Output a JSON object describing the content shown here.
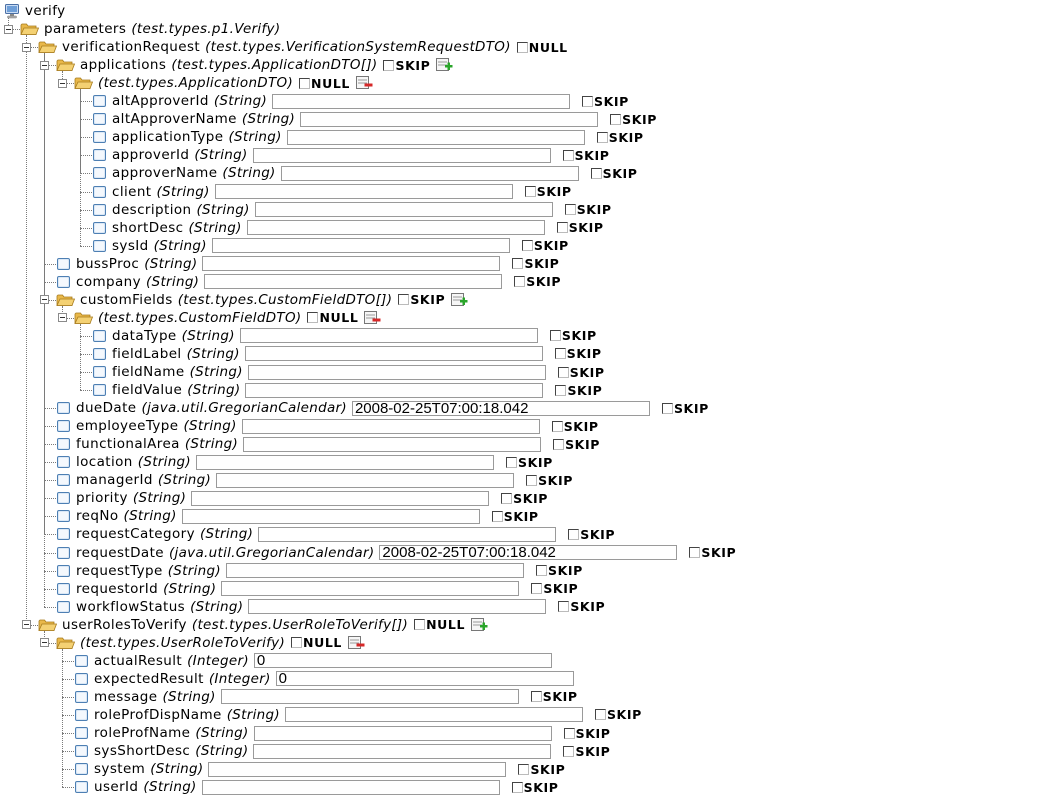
{
  "tree": [
    {
      "depth": 0,
      "icon": "root",
      "name": "verify"
    },
    {
      "depth": 1,
      "icon": "folder",
      "name": "parameters",
      "type": "(test.types.p1.Verify)"
    },
    {
      "depth": 2,
      "icon": "folder",
      "name": "verificationRequest",
      "type": "(test.types.VerificationSystemRequestDTO)",
      "flag": "NULL"
    },
    {
      "depth": 3,
      "icon": "folder",
      "name": "applications",
      "type": "(test.types.ApplicationDTO[])",
      "flag": "SKIP",
      "action": "add"
    },
    {
      "depth": 4,
      "icon": "folder",
      "name": "",
      "type": "(test.types.ApplicationDTO)",
      "flag": "NULL",
      "action": "remove"
    },
    {
      "depth": 5,
      "icon": "file",
      "name": "altApproverId",
      "type": "(String)",
      "input": "",
      "flag": "SKIP"
    },
    {
      "depth": 5,
      "icon": "file",
      "name": "altApproverName",
      "type": "(String)",
      "input": "",
      "flag": "SKIP"
    },
    {
      "depth": 5,
      "icon": "file",
      "name": "applicationType",
      "type": "(String)",
      "input": "",
      "flag": "SKIP"
    },
    {
      "depth": 5,
      "icon": "file",
      "name": "approverId",
      "type": "(String)",
      "input": "",
      "flag": "SKIP"
    },
    {
      "depth": 5,
      "icon": "file",
      "name": "approverName",
      "type": "(String)",
      "input": "",
      "flag": "SKIP"
    },
    {
      "depth": 5,
      "icon": "file",
      "name": "client",
      "type": "(String)",
      "input": "",
      "flag": "SKIP"
    },
    {
      "depth": 5,
      "icon": "file",
      "name": "description",
      "type": "(String)",
      "input": "",
      "flag": "SKIP"
    },
    {
      "depth": 5,
      "icon": "file",
      "name": "shortDesc",
      "type": "(String)",
      "input": "",
      "flag": "SKIP"
    },
    {
      "depth": 5,
      "icon": "file",
      "name": "sysId",
      "type": "(String)",
      "input": "",
      "flag": "SKIP"
    },
    {
      "depth": 3,
      "icon": "file",
      "name": "bussProc",
      "type": "(String)",
      "input": "",
      "flag": "SKIP"
    },
    {
      "depth": 3,
      "icon": "file",
      "name": "company",
      "type": "(String)",
      "input": "",
      "flag": "SKIP"
    },
    {
      "depth": 3,
      "icon": "folder",
      "name": "customFields",
      "type": "(test.types.CustomFieldDTO[])",
      "flag": "SKIP",
      "action": "add"
    },
    {
      "depth": 4,
      "icon": "folder",
      "name": "",
      "type": "(test.types.CustomFieldDTO)",
      "flag": "NULL",
      "action": "remove"
    },
    {
      "depth": 5,
      "icon": "file",
      "name": "dataType",
      "type": "(String)",
      "input": "",
      "flag": "SKIP"
    },
    {
      "depth": 5,
      "icon": "file",
      "name": "fieldLabel",
      "type": "(String)",
      "input": "",
      "flag": "SKIP"
    },
    {
      "depth": 5,
      "icon": "file",
      "name": "fieldName",
      "type": "(String)",
      "input": "",
      "flag": "SKIP"
    },
    {
      "depth": 5,
      "icon": "file",
      "name": "fieldValue",
      "type": "(String)",
      "input": "",
      "flag": "SKIP"
    },
    {
      "depth": 3,
      "icon": "file",
      "name": "dueDate",
      "type": "(java.util.GregorianCalendar)",
      "input": "2008-02-25T07:00:18.042",
      "flag": "SKIP"
    },
    {
      "depth": 3,
      "icon": "file",
      "name": "employeeType",
      "type": "(String)",
      "input": "",
      "flag": "SKIP"
    },
    {
      "depth": 3,
      "icon": "file",
      "name": "functionalArea",
      "type": "(String)",
      "input": "",
      "flag": "SKIP"
    },
    {
      "depth": 3,
      "icon": "file",
      "name": "location",
      "type": "(String)",
      "input": "",
      "flag": "SKIP"
    },
    {
      "depth": 3,
      "icon": "file",
      "name": "managerId",
      "type": "(String)",
      "input": "",
      "flag": "SKIP"
    },
    {
      "depth": 3,
      "icon": "file",
      "name": "priority",
      "type": "(String)",
      "input": "",
      "flag": "SKIP"
    },
    {
      "depth": 3,
      "icon": "file",
      "name": "reqNo",
      "type": "(String)",
      "input": "",
      "flag": "SKIP"
    },
    {
      "depth": 3,
      "icon": "file",
      "name": "requestCategory",
      "type": "(String)",
      "input": "",
      "flag": "SKIP"
    },
    {
      "depth": 3,
      "icon": "file",
      "name": "requestDate",
      "type": "(java.util.GregorianCalendar)",
      "input": "2008-02-25T07:00:18.042",
      "flag": "SKIP"
    },
    {
      "depth": 3,
      "icon": "file",
      "name": "requestType",
      "type": "(String)",
      "input": "",
      "flag": "SKIP"
    },
    {
      "depth": 3,
      "icon": "file",
      "name": "requestorId",
      "type": "(String)",
      "input": "",
      "flag": "SKIP"
    },
    {
      "depth": 3,
      "icon": "file",
      "name": "workflowStatus",
      "type": "(String)",
      "input": "",
      "flag": "SKIP"
    },
    {
      "depth": 2,
      "icon": "folder",
      "name": "userRolesToVerify",
      "type": "(test.types.UserRoleToVerify[])",
      "flag": "NULL",
      "action": "add"
    },
    {
      "depth": 3,
      "icon": "folder",
      "name": "",
      "type": "(test.types.UserRoleToVerify)",
      "flag": "NULL",
      "action": "remove"
    },
    {
      "depth": 4,
      "icon": "file",
      "name": "actualResult",
      "type": "(Integer)",
      "input": "0"
    },
    {
      "depth": 4,
      "icon": "file",
      "name": "expectedResult",
      "type": "(Integer)",
      "input": "0"
    },
    {
      "depth": 4,
      "icon": "file",
      "name": "message",
      "type": "(String)",
      "input": "",
      "flag": "SKIP"
    },
    {
      "depth": 4,
      "icon": "file",
      "name": "roleProfDispName",
      "type": "(String)",
      "input": "",
      "flag": "SKIP"
    },
    {
      "depth": 4,
      "icon": "file",
      "name": "roleProfName",
      "type": "(String)",
      "input": "",
      "flag": "SKIP"
    },
    {
      "depth": 4,
      "icon": "file",
      "name": "sysShortDesc",
      "type": "(String)",
      "input": "",
      "flag": "SKIP"
    },
    {
      "depth": 4,
      "icon": "file",
      "name": "system",
      "type": "(String)",
      "input": "",
      "flag": "SKIP"
    },
    {
      "depth": 4,
      "icon": "file",
      "name": "userId",
      "type": "(String)",
      "input": "",
      "flag": "SKIP"
    }
  ],
  "icons": {
    "root": "computer-icon",
    "folder": "folder-open-icon",
    "file": "field-node-icon",
    "add": "add-row-icon",
    "remove": "remove-row-icon"
  },
  "colors": {
    "folder": "#f4d173",
    "file": "#dbe8f6",
    "add": "#2aa52a",
    "remove": "#d62828"
  }
}
